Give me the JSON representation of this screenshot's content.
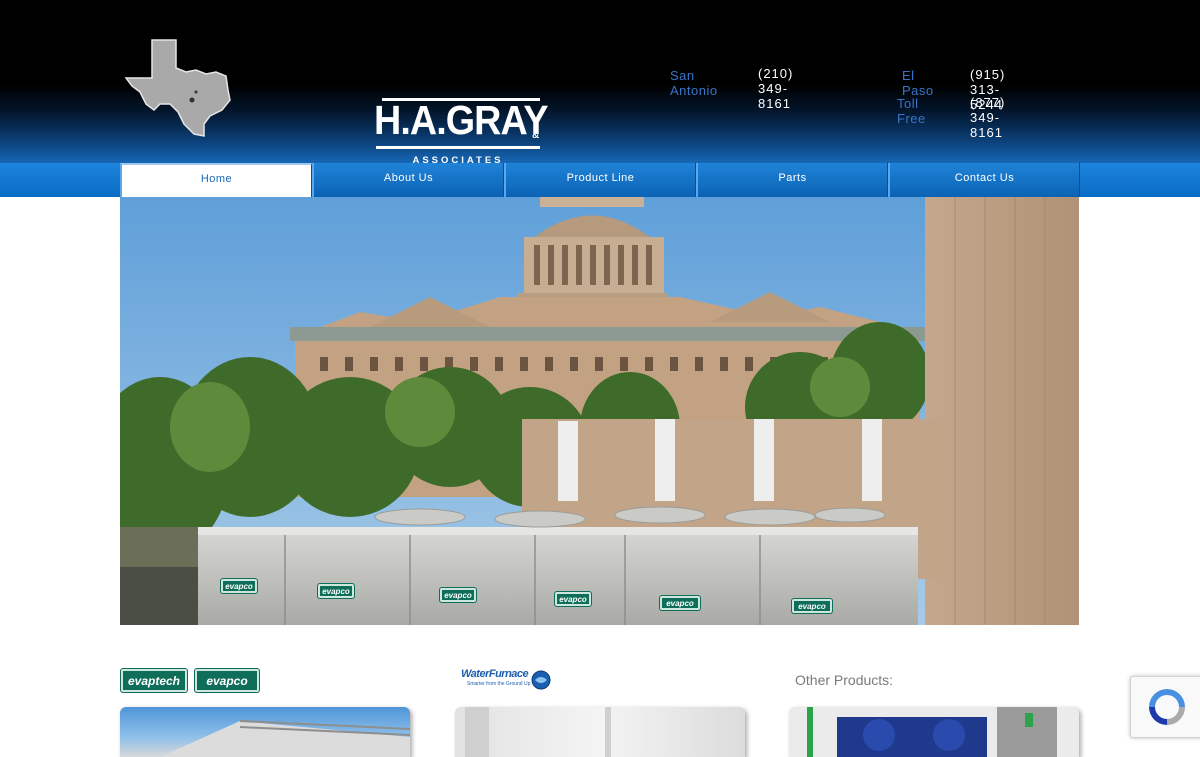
{
  "header": {
    "logo": {
      "wordmark": "H.A.GRAY",
      "ampersand": "&",
      "subtitle": "ASSOCIATES"
    },
    "contacts": [
      {
        "label": "San Antonio",
        "phone": "(210) 349-8161"
      },
      {
        "label": "El Paso",
        "phone": "(915) 313-5244"
      },
      {
        "label": "Toll Free",
        "phone": "(877) 349-8161"
      }
    ]
  },
  "nav": {
    "items": [
      {
        "label": "Home",
        "active": true
      },
      {
        "label": "About Us",
        "active": false
      },
      {
        "label": "Product Line",
        "active": false
      },
      {
        "label": "Parts",
        "active": false
      },
      {
        "label": "Contact Us",
        "active": false
      }
    ]
  },
  "hero": {
    "unit_badge": "evapco"
  },
  "products": {
    "evapco_logos": [
      "evaptech",
      "evapco"
    ],
    "waterfurnace_logo": "WaterFurnace",
    "waterfurnace_tagline": "Smarter from the Ground Up",
    "other_title": "Other Products:"
  },
  "colors": {
    "nav_blue": "#0a6cc4",
    "label_blue": "#3a74c8",
    "evapco_green": "#0f6e5a"
  }
}
